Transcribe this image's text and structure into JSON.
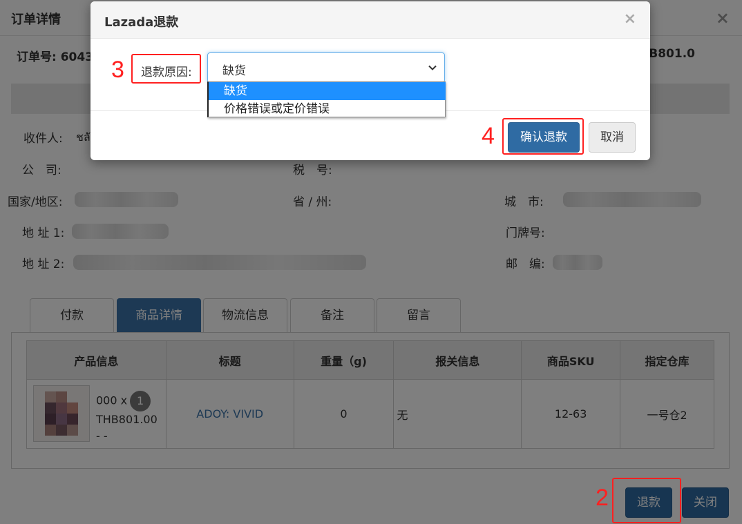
{
  "page": {
    "title": "订单详情",
    "order_label": "订单号: 6043",
    "order_total_fragment": "THB801.0",
    "fields": {
      "recipient_label": "收件人:",
      "recipient_value_fragment": "ชลั",
      "company_label": "公　司:",
      "tax_label": "税　号:",
      "country_label": "国家/地区:",
      "province_label": "省 / 州:",
      "city_label": "城　市:",
      "address1_label": "地 址 1:",
      "house_no_label": "门牌号:",
      "address2_label": "地 址 2:",
      "zip_label": "邮　编:"
    },
    "tabs": [
      "付款",
      "商品详情",
      "物流信息",
      "备注",
      "留言"
    ],
    "active_tab": 1,
    "table": {
      "headers": [
        "产品信息",
        "标题",
        "重量（g)",
        "报关信息",
        "商品SKU",
        "指定仓库"
      ],
      "rows": [
        {
          "qty_prefix": "000 x",
          "qty": "1",
          "price": "THB801.00",
          "extra": "- -",
          "title": "ADOY: VIVID",
          "weight": "0",
          "customs": "无",
          "sku": "12-63",
          "warehouse": "一号仓2"
        }
      ]
    },
    "buttons": {
      "refund": "退款",
      "close": "关闭"
    }
  },
  "modal": {
    "title": "Lazada退款",
    "close_icon": "×",
    "reason_label": "退款原因:",
    "reason_selected": "缺货",
    "reason_options": [
      "缺货",
      "价格错误或定价错误"
    ],
    "confirm_label": "确认退款",
    "cancel_label": "取消"
  },
  "annotations": {
    "step2": "2",
    "step3": "3",
    "step4": "4"
  },
  "colors": {
    "primary": "#2f6ba3",
    "highlight": "#1e90ff",
    "annotation_red": "#ff2020",
    "link": "#3b73a8"
  }
}
